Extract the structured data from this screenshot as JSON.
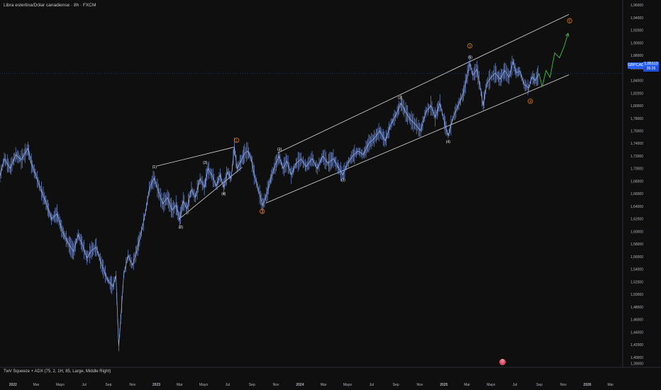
{
  "header": {
    "title": "Libra esterlina/Dólar canadiense · 8h · FXCM"
  },
  "indicator": {
    "label": "TwV Squeeze + ADX (75, 2, 1H, 85, Large, Middle Right)"
  },
  "price_tag": {
    "symbol": "GBPCAD",
    "price": "1,85113",
    "countdown": "06:26"
  },
  "alert_icon": "clock-icon",
  "colors": {
    "background": "#0f0f0f",
    "candles": "#6f8fe0",
    "channel": "#d9d9d9",
    "projection": "#3fae3f",
    "wave_orange": "#e0791f",
    "wave_white": "#ffffff",
    "price_line": "#2962ff"
  },
  "chart_data": {
    "type": "line",
    "title": "Libra esterlina/Dólar canadiense · 8h · FXCM",
    "y_axis": {
      "ylim": [
        1.384,
        1.968
      ],
      "ticks": [
        "1,96000",
        "1,94000",
        "1,92000",
        "1,90000",
        "1,88000",
        "1,86000",
        "1,84000",
        "1,82000",
        "1,80000",
        "1,78000",
        "1,76000",
        "1,74000",
        "1,72000",
        "1,70000",
        "1,68000",
        "1,66000",
        "1,64000",
        "1,62000",
        "1,60000",
        "1,58000",
        "1,56000",
        "1,54000",
        "1,52000",
        "1,50000",
        "1,48000",
        "1,46000",
        "1,44000",
        "1,42000",
        "1,40000",
        "1,39000"
      ],
      "tick_values": [
        1.96,
        1.94,
        1.92,
        1.9,
        1.88,
        1.86,
        1.84,
        1.82,
        1.8,
        1.78,
        1.76,
        1.74,
        1.72,
        1.7,
        1.68,
        1.66,
        1.64,
        1.62,
        1.6,
        1.58,
        1.56,
        1.54,
        1.52,
        1.5,
        1.48,
        1.46,
        1.44,
        1.42,
        1.4,
        1.39
      ]
    },
    "x_axis": {
      "range": [
        "2021-11-29",
        "2026-04-01"
      ],
      "ticks": [
        {
          "label": "2022",
          "date": "2022-01-01",
          "bold": true
        },
        {
          "label": "Mar",
          "date": "2022-03-01"
        },
        {
          "label": "Mayo",
          "date": "2022-05-01"
        },
        {
          "label": "Jul",
          "date": "2022-07-01"
        },
        {
          "label": "Sep",
          "date": "2022-09-01"
        },
        {
          "label": "Nov",
          "date": "2022-11-01"
        },
        {
          "label": "2023",
          "date": "2023-01-01",
          "bold": true
        },
        {
          "label": "Mar",
          "date": "2023-03-01"
        },
        {
          "label": "Mayo",
          "date": "2023-05-01"
        },
        {
          "label": "Jul",
          "date": "2023-07-01"
        },
        {
          "label": "Sep",
          "date": "2023-09-01"
        },
        {
          "label": "Nov",
          "date": "2023-11-01"
        },
        {
          "label": "2024",
          "date": "2024-01-01",
          "bold": true
        },
        {
          "label": "Mar",
          "date": "2024-03-01"
        },
        {
          "label": "Mayo",
          "date": "2024-05-01"
        },
        {
          "label": "Jul",
          "date": "2024-07-01"
        },
        {
          "label": "Sep",
          "date": "2024-09-01"
        },
        {
          "label": "Nov",
          "date": "2024-11-01"
        },
        {
          "label": "2025",
          "date": "2025-01-01",
          "bold": true
        },
        {
          "label": "Mar",
          "date": "2025-03-01"
        },
        {
          "label": "Mayo",
          "date": "2025-05-01"
        },
        {
          "label": "Jul",
          "date": "2025-07-01"
        },
        {
          "label": "Sep",
          "date": "2025-09-01"
        },
        {
          "label": "Nov",
          "date": "2025-11-01"
        },
        {
          "label": "2026",
          "date": "2026-01-01",
          "bold": true
        },
        {
          "label": "Mar",
          "date": "2026-03-01"
        }
      ]
    },
    "series": [
      {
        "points": [
          [
            "2021-11-29",
            1.688
          ],
          [
            "2021-12-10",
            1.716
          ],
          [
            "2021-12-25",
            1.7
          ],
          [
            "2022-01-08",
            1.722
          ],
          [
            "2022-01-22",
            1.714
          ],
          [
            "2022-02-08",
            1.732
          ],
          [
            "2022-02-17",
            1.708
          ],
          [
            "2022-03-01",
            1.688
          ],
          [
            "2022-03-12",
            1.668
          ],
          [
            "2022-03-26",
            1.646
          ],
          [
            "2022-04-09",
            1.62
          ],
          [
            "2022-04-23",
            1.628
          ],
          [
            "2022-05-07",
            1.6
          ],
          [
            "2022-05-21",
            1.582
          ],
          [
            "2022-06-04",
            1.568
          ],
          [
            "2022-06-16",
            1.595
          ],
          [
            "2022-06-26",
            1.58
          ],
          [
            "2022-07-08",
            1.558
          ],
          [
            "2022-07-20",
            1.57
          ],
          [
            "2022-08-01",
            1.575
          ],
          [
            "2022-08-14",
            1.548
          ],
          [
            "2022-08-29",
            1.524
          ],
          [
            "2022-09-12",
            1.512
          ],
          [
            "2022-09-20",
            1.53
          ],
          [
            "2022-09-27",
            1.418
          ],
          [
            "2022-10-02",
            1.46
          ],
          [
            "2022-10-10",
            1.532
          ],
          [
            "2022-10-21",
            1.562
          ],
          [
            "2022-11-01",
            1.546
          ],
          [
            "2022-11-12",
            1.57
          ],
          [
            "2022-11-24",
            1.6
          ],
          [
            "2022-12-04",
            1.63
          ],
          [
            "2022-12-14",
            1.668
          ],
          [
            "2022-12-26",
            1.685
          ],
          [
            "2023-01-06",
            1.664
          ],
          [
            "2023-01-17",
            1.644
          ],
          [
            "2023-01-29",
            1.654
          ],
          [
            "2023-02-10",
            1.634
          ],
          [
            "2023-02-20",
            1.642
          ],
          [
            "2023-03-01",
            1.618
          ],
          [
            "2023-03-10",
            1.648
          ],
          [
            "2023-03-20",
            1.636
          ],
          [
            "2023-03-31",
            1.667
          ],
          [
            "2023-04-10",
            1.654
          ],
          [
            "2023-04-22",
            1.684
          ],
          [
            "2023-05-03",
            1.67
          ],
          [
            "2023-05-12",
            1.7
          ],
          [
            "2023-05-22",
            1.69
          ],
          [
            "2023-06-02",
            1.672
          ],
          [
            "2023-06-12",
            1.69
          ],
          [
            "2023-06-21",
            1.67
          ],
          [
            "2023-07-01",
            1.695
          ],
          [
            "2023-07-10",
            1.684
          ],
          [
            "2023-07-18",
            1.735
          ],
          [
            "2023-07-25",
            1.7
          ],
          [
            "2023-08-04",
            1.712
          ],
          [
            "2023-08-13",
            1.724
          ],
          [
            "2023-08-21",
            1.728
          ],
          [
            "2023-08-30",
            1.716
          ],
          [
            "2023-09-07",
            1.69
          ],
          [
            "2023-09-18",
            1.665
          ],
          [
            "2023-09-28",
            1.641
          ],
          [
            "2023-10-08",
            1.658
          ],
          [
            "2023-10-18",
            1.683
          ],
          [
            "2023-10-30",
            1.705
          ],
          [
            "2023-11-09",
            1.72
          ],
          [
            "2023-11-19",
            1.7
          ],
          [
            "2023-11-29",
            1.712
          ],
          [
            "2023-12-10",
            1.69
          ],
          [
            "2023-12-22",
            1.708
          ],
          [
            "2024-01-04",
            1.715
          ],
          [
            "2024-01-17",
            1.703
          ],
          [
            "2024-02-01",
            1.716
          ],
          [
            "2024-02-14",
            1.7
          ],
          [
            "2024-02-28",
            1.72
          ],
          [
            "2024-03-12",
            1.708
          ],
          [
            "2024-03-26",
            1.716
          ],
          [
            "2024-04-09",
            1.7
          ],
          [
            "2024-04-19",
            1.69
          ],
          [
            "2024-05-01",
            1.708
          ],
          [
            "2024-05-14",
            1.72
          ],
          [
            "2024-05-28",
            1.728
          ],
          [
            "2024-06-10",
            1.722
          ],
          [
            "2024-06-24",
            1.74
          ],
          [
            "2024-07-08",
            1.748
          ],
          [
            "2024-07-22",
            1.76
          ],
          [
            "2024-08-05",
            1.744
          ],
          [
            "2024-08-19",
            1.77
          ],
          [
            "2024-09-02",
            1.786
          ],
          [
            "2024-09-14",
            1.804
          ],
          [
            "2024-09-26",
            1.79
          ],
          [
            "2024-10-08",
            1.778
          ],
          [
            "2024-10-21",
            1.77
          ],
          [
            "2024-11-03",
            1.76
          ],
          [
            "2024-11-16",
            1.79
          ],
          [
            "2024-11-29",
            1.8
          ],
          [
            "2024-12-10",
            1.782
          ],
          [
            "2024-12-22",
            1.804
          ],
          [
            "2025-01-02",
            1.775
          ],
          [
            "2025-01-12",
            1.752
          ],
          [
            "2025-01-24",
            1.78
          ],
          [
            "2025-02-06",
            1.8
          ],
          [
            "2025-02-20",
            1.82
          ],
          [
            "2025-03-02",
            1.85
          ],
          [
            "2025-03-08",
            1.868
          ],
          [
            "2025-03-16",
            1.848
          ],
          [
            "2025-03-26",
            1.858
          ],
          [
            "2025-04-03",
            1.832
          ],
          [
            "2025-04-11",
            1.8
          ],
          [
            "2025-04-20",
            1.835
          ],
          [
            "2025-05-01",
            1.845
          ],
          [
            "2025-05-12",
            1.852
          ],
          [
            "2025-05-24",
            1.842
          ],
          [
            "2025-06-05",
            1.856
          ],
          [
            "2025-06-16",
            1.845
          ],
          [
            "2025-06-26",
            1.87
          ],
          [
            "2025-07-04",
            1.852
          ],
          [
            "2025-07-13",
            1.855
          ],
          [
            "2025-07-24",
            1.834
          ],
          [
            "2025-08-05",
            1.828
          ],
          [
            "2025-08-13",
            1.846
          ],
          [
            "2025-08-22",
            1.84
          ],
          [
            "2025-08-31",
            1.851
          ]
        ]
      },
      {
        "points": [
          [
            "2025-08-31",
            1.851
          ],
          [
            "2025-09-08",
            1.83
          ],
          [
            "2025-09-18",
            1.856
          ],
          [
            "2025-09-28",
            1.845
          ],
          [
            "2025-10-10",
            1.884
          ],
          [
            "2025-10-22",
            1.876
          ],
          [
            "2025-11-03",
            1.894
          ],
          [
            "2025-11-13",
            1.915
          ]
        ]
      }
    ],
    "trendlines": [
      {
        "from": [
          "2023-10-06",
          1.645
        ],
        "to": [
          "2025-11-15",
          1.849
        ]
      },
      {
        "from": [
          "2023-11-06",
          1.725
        ],
        "to": [
          "2025-11-15",
          1.945
        ]
      },
      {
        "from": [
          "2023-01-02",
          1.704
        ],
        "to": [
          "2023-07-17",
          1.734
        ]
      },
      {
        "from": [
          "2023-03-04",
          1.622
        ],
        "to": [
          "2023-08-07",
          1.702
        ]
      }
    ],
    "annotations": [
      {
        "text": "1",
        "date": "2023-07-24",
        "value": 1.745,
        "style": "orange"
      },
      {
        "text": "2",
        "date": "2023-09-27",
        "value": 1.632,
        "style": "orange"
      },
      {
        "text": "3",
        "date": "2025-03-08",
        "value": 1.895,
        "style": "orange"
      },
      {
        "text": "4",
        "date": "2025-08-09",
        "value": 1.807,
        "style": "orange"
      },
      {
        "text": "5",
        "date": "2025-11-17",
        "value": 1.935,
        "style": "orange"
      },
      {
        "text": "(1)",
        "date": "2022-12-27",
        "value": 1.703,
        "style": "white"
      },
      {
        "text": "(2)",
        "date": "2023-03-04",
        "value": 1.607,
        "style": "white"
      },
      {
        "text": "(3)",
        "date": "2023-05-05",
        "value": 1.71,
        "style": "white"
      },
      {
        "text": "(4)",
        "date": "2023-06-21",
        "value": 1.66,
        "style": "white"
      },
      {
        "text": "(1)",
        "date": "2023-11-10",
        "value": 1.731,
        "style": "white"
      },
      {
        "text": "(2)",
        "date": "2024-04-20",
        "value": 1.682,
        "style": "white"
      },
      {
        "text": "(3)",
        "date": "2024-09-12",
        "value": 1.813,
        "style": "white"
      },
      {
        "text": "(4)",
        "date": "2025-01-12",
        "value": 1.743,
        "style": "white"
      },
      {
        "text": "(5)",
        "date": "2025-03-09",
        "value": 1.877,
        "style": "white"
      }
    ],
    "grid": false,
    "legend": "none"
  }
}
